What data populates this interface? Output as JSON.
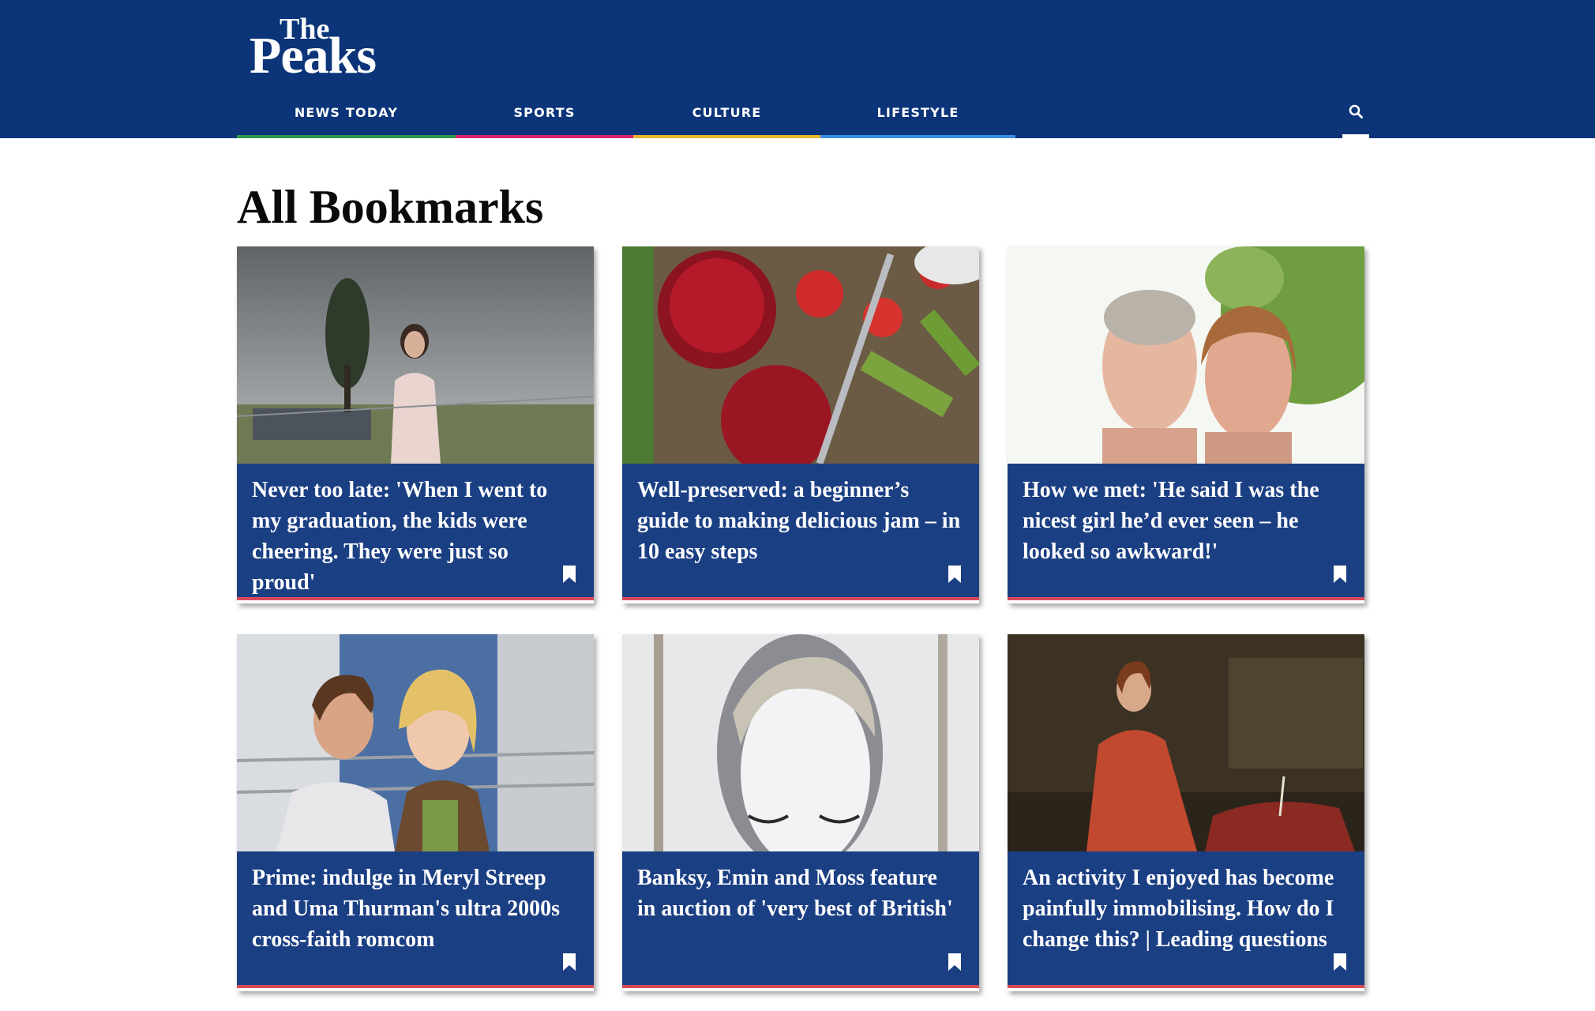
{
  "site": {
    "logo_the": "The",
    "logo_peaks": "Peaks"
  },
  "nav": [
    {
      "label": "NEWS TODAY",
      "color": "#2e9b4c"
    },
    {
      "label": "SPORTS",
      "color": "#d8246e"
    },
    {
      "label": "CULTURE",
      "color": "#e8b52c"
    },
    {
      "label": "LIFESTYLE",
      "color": "#3a8fe0"
    }
  ],
  "search": {
    "icon": "search-icon"
  },
  "page": {
    "title": "All Bookmarks"
  },
  "cards": [
    {
      "title": "Never too late: 'When I went to my graduation, the kids were cheering. They were just so proud'",
      "icon": "bookmark-icon"
    },
    {
      "title": "Well-preserved: a beginner’s guide to making delicious jam – in 10 easy steps",
      "icon": "bookmark-icon"
    },
    {
      "title": "How we met: 'He said I was the nicest girl he’d ever seen – he looked so awkward!'",
      "icon": "bookmark-icon"
    },
    {
      "title": "Prime: indulge in Meryl Streep and Uma Thurman's ultra 2000s cross-faith romcom",
      "icon": "bookmark-icon"
    },
    {
      "title": "Banksy, Emin and Moss feature in auction of 'very best of British'",
      "icon": "bookmark-icon"
    },
    {
      "title": "An activity I enjoyed has become painfully immobilising. How do I change this? | Leading questions",
      "icon": "bookmark-icon"
    }
  ],
  "colors": {
    "header_bg": "#0b3479",
    "caption_bg": "#1b3f83",
    "card_accent": "#d84a5a"
  }
}
